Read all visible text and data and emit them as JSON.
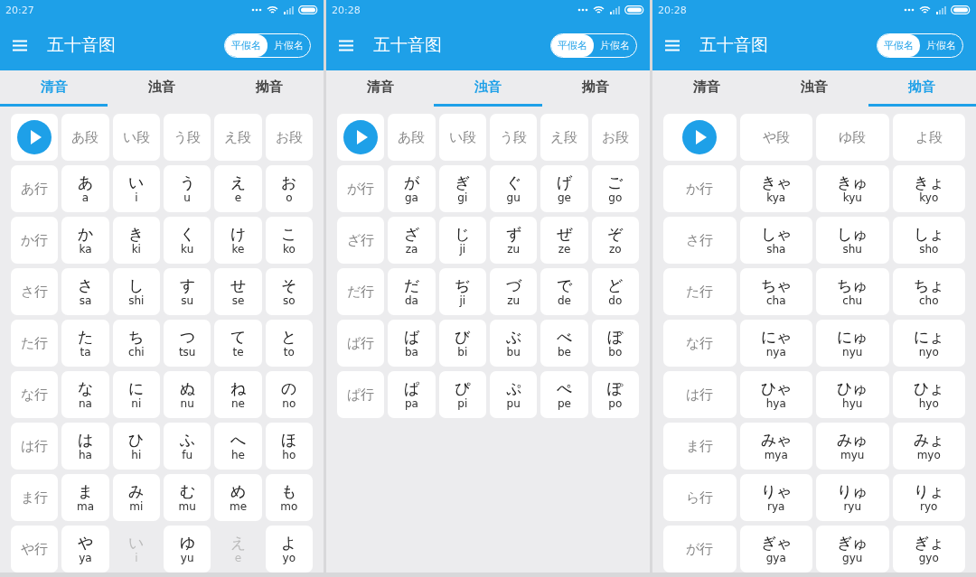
{
  "screens": [
    {
      "time": "20:27",
      "title": "五十音图",
      "toggle": [
        {
          "label": "平假名",
          "selected": true
        },
        {
          "label": "片假名",
          "selected": false
        }
      ],
      "tabs": [
        {
          "label": "清音",
          "selected": true
        },
        {
          "label": "浊音",
          "selected": false
        },
        {
          "label": "拗音",
          "selected": false
        }
      ],
      "columns": [
        "あ段",
        "い段",
        "う段",
        "え段",
        "お段"
      ],
      "rows": [
        {
          "label": "あ行",
          "cells": [
            {
              "kana": "あ",
              "romaji": "a",
              "disabled": false
            },
            {
              "kana": "い",
              "romaji": "i",
              "disabled": false
            },
            {
              "kana": "う",
              "romaji": "u",
              "disabled": false
            },
            {
              "kana": "え",
              "romaji": "e",
              "disabled": false
            },
            {
              "kana": "お",
              "romaji": "o",
              "disabled": false
            }
          ]
        },
        {
          "label": "か行",
          "cells": [
            {
              "kana": "か",
              "romaji": "ka",
              "disabled": false
            },
            {
              "kana": "き",
              "romaji": "ki",
              "disabled": false
            },
            {
              "kana": "く",
              "romaji": "ku",
              "disabled": false
            },
            {
              "kana": "け",
              "romaji": "ke",
              "disabled": false
            },
            {
              "kana": "こ",
              "romaji": "ko",
              "disabled": false
            }
          ]
        },
        {
          "label": "さ行",
          "cells": [
            {
              "kana": "さ",
              "romaji": "sa",
              "disabled": false
            },
            {
              "kana": "し",
              "romaji": "shi",
              "disabled": false
            },
            {
              "kana": "す",
              "romaji": "su",
              "disabled": false
            },
            {
              "kana": "せ",
              "romaji": "se",
              "disabled": false
            },
            {
              "kana": "そ",
              "romaji": "so",
              "disabled": false
            }
          ]
        },
        {
          "label": "た行",
          "cells": [
            {
              "kana": "た",
              "romaji": "ta",
              "disabled": false
            },
            {
              "kana": "ち",
              "romaji": "chi",
              "disabled": false
            },
            {
              "kana": "つ",
              "romaji": "tsu",
              "disabled": false
            },
            {
              "kana": "て",
              "romaji": "te",
              "disabled": false
            },
            {
              "kana": "と",
              "romaji": "to",
              "disabled": false
            }
          ]
        },
        {
          "label": "な行",
          "cells": [
            {
              "kana": "な",
              "romaji": "na",
              "disabled": false
            },
            {
              "kana": "に",
              "romaji": "ni",
              "disabled": false
            },
            {
              "kana": "ぬ",
              "romaji": "nu",
              "disabled": false
            },
            {
              "kana": "ね",
              "romaji": "ne",
              "disabled": false
            },
            {
              "kana": "の",
              "romaji": "no",
              "disabled": false
            }
          ]
        },
        {
          "label": "は行",
          "cells": [
            {
              "kana": "は",
              "romaji": "ha",
              "disabled": false
            },
            {
              "kana": "ひ",
              "romaji": "hi",
              "disabled": false
            },
            {
              "kana": "ふ",
              "romaji": "fu",
              "disabled": false
            },
            {
              "kana": "へ",
              "romaji": "he",
              "disabled": false
            },
            {
              "kana": "ほ",
              "romaji": "ho",
              "disabled": false
            }
          ]
        },
        {
          "label": "ま行",
          "cells": [
            {
              "kana": "ま",
              "romaji": "ma",
              "disabled": false
            },
            {
              "kana": "み",
              "romaji": "mi",
              "disabled": false
            },
            {
              "kana": "む",
              "romaji": "mu",
              "disabled": false
            },
            {
              "kana": "め",
              "romaji": "me",
              "disabled": false
            },
            {
              "kana": "も",
              "romaji": "mo",
              "disabled": false
            }
          ]
        },
        {
          "label": "や行",
          "cells": [
            {
              "kana": "や",
              "romaji": "ya",
              "disabled": false
            },
            {
              "kana": "い",
              "romaji": "i",
              "disabled": true
            },
            {
              "kana": "ゆ",
              "romaji": "yu",
              "disabled": false
            },
            {
              "kana": "え",
              "romaji": "e",
              "disabled": true
            },
            {
              "kana": "よ",
              "romaji": "yo",
              "disabled": false
            }
          ]
        }
      ]
    },
    {
      "time": "20:28",
      "title": "五十音图",
      "toggle": [
        {
          "label": "平假名",
          "selected": true
        },
        {
          "label": "片假名",
          "selected": false
        }
      ],
      "tabs": [
        {
          "label": "清音",
          "selected": false
        },
        {
          "label": "浊音",
          "selected": true
        },
        {
          "label": "拗音",
          "selected": false
        }
      ],
      "columns": [
        "あ段",
        "い段",
        "う段",
        "え段",
        "お段"
      ],
      "rows": [
        {
          "label": "が行",
          "cells": [
            {
              "kana": "が",
              "romaji": "ga",
              "disabled": false
            },
            {
              "kana": "ぎ",
              "romaji": "gi",
              "disabled": false
            },
            {
              "kana": "ぐ",
              "romaji": "gu",
              "disabled": false
            },
            {
              "kana": "げ",
              "romaji": "ge",
              "disabled": false
            },
            {
              "kana": "ご",
              "romaji": "go",
              "disabled": false
            }
          ]
        },
        {
          "label": "ざ行",
          "cells": [
            {
              "kana": "ざ",
              "romaji": "za",
              "disabled": false
            },
            {
              "kana": "じ",
              "romaji": "ji",
              "disabled": false
            },
            {
              "kana": "ず",
              "romaji": "zu",
              "disabled": false
            },
            {
              "kana": "ぜ",
              "romaji": "ze",
              "disabled": false
            },
            {
              "kana": "ぞ",
              "romaji": "zo",
              "disabled": false
            }
          ]
        },
        {
          "label": "だ行",
          "cells": [
            {
              "kana": "だ",
              "romaji": "da",
              "disabled": false
            },
            {
              "kana": "ぢ",
              "romaji": "ji",
              "disabled": false
            },
            {
              "kana": "づ",
              "romaji": "zu",
              "disabled": false
            },
            {
              "kana": "で",
              "romaji": "de",
              "disabled": false
            },
            {
              "kana": "ど",
              "romaji": "do",
              "disabled": false
            }
          ]
        },
        {
          "label": "ば行",
          "cells": [
            {
              "kana": "ば",
              "romaji": "ba",
              "disabled": false
            },
            {
              "kana": "び",
              "romaji": "bi",
              "disabled": false
            },
            {
              "kana": "ぶ",
              "romaji": "bu",
              "disabled": false
            },
            {
              "kana": "べ",
              "romaji": "be",
              "disabled": false
            },
            {
              "kana": "ぼ",
              "romaji": "bo",
              "disabled": false
            }
          ]
        },
        {
          "label": "ぱ行",
          "cells": [
            {
              "kana": "ぱ",
              "romaji": "pa",
              "disabled": false
            },
            {
              "kana": "ぴ",
              "romaji": "pi",
              "disabled": false
            },
            {
              "kana": "ぷ",
              "romaji": "pu",
              "disabled": false
            },
            {
              "kana": "ぺ",
              "romaji": "pe",
              "disabled": false
            },
            {
              "kana": "ぽ",
              "romaji": "po",
              "disabled": false
            }
          ]
        }
      ]
    },
    {
      "time": "20:28",
      "title": "五十音图",
      "toggle": [
        {
          "label": "平假名",
          "selected": true
        },
        {
          "label": "片假名",
          "selected": false
        }
      ],
      "tabs": [
        {
          "label": "清音",
          "selected": false
        },
        {
          "label": "浊音",
          "selected": false
        },
        {
          "label": "拗音",
          "selected": true
        }
      ],
      "columns": [
        "や段",
        "ゆ段",
        "よ段"
      ],
      "rows": [
        {
          "label": "か行",
          "cells": [
            {
              "kana": "きゃ",
              "romaji": "kya",
              "disabled": false
            },
            {
              "kana": "きゅ",
              "romaji": "kyu",
              "disabled": false
            },
            {
              "kana": "きょ",
              "romaji": "kyo",
              "disabled": false
            }
          ]
        },
        {
          "label": "さ行",
          "cells": [
            {
              "kana": "しゃ",
              "romaji": "sha",
              "disabled": false
            },
            {
              "kana": "しゅ",
              "romaji": "shu",
              "disabled": false
            },
            {
              "kana": "しょ",
              "romaji": "sho",
              "disabled": false
            }
          ]
        },
        {
          "label": "た行",
          "cells": [
            {
              "kana": "ちゃ",
              "romaji": "cha",
              "disabled": false
            },
            {
              "kana": "ちゅ",
              "romaji": "chu",
              "disabled": false
            },
            {
              "kana": "ちょ",
              "romaji": "cho",
              "disabled": false
            }
          ]
        },
        {
          "label": "な行",
          "cells": [
            {
              "kana": "にゃ",
              "romaji": "nya",
              "disabled": false
            },
            {
              "kana": "にゅ",
              "romaji": "nyu",
              "disabled": false
            },
            {
              "kana": "にょ",
              "romaji": "nyo",
              "disabled": false
            }
          ]
        },
        {
          "label": "は行",
          "cells": [
            {
              "kana": "ひゃ",
              "romaji": "hya",
              "disabled": false
            },
            {
              "kana": "ひゅ",
              "romaji": "hyu",
              "disabled": false
            },
            {
              "kana": "ひょ",
              "romaji": "hyo",
              "disabled": false
            }
          ]
        },
        {
          "label": "ま行",
          "cells": [
            {
              "kana": "みゃ",
              "romaji": "mya",
              "disabled": false
            },
            {
              "kana": "みゅ",
              "romaji": "myu",
              "disabled": false
            },
            {
              "kana": "みょ",
              "romaji": "myo",
              "disabled": false
            }
          ]
        },
        {
          "label": "ら行",
          "cells": [
            {
              "kana": "りゃ",
              "romaji": "rya",
              "disabled": false
            },
            {
              "kana": "りゅ",
              "romaji": "ryu",
              "disabled": false
            },
            {
              "kana": "りょ",
              "romaji": "ryo",
              "disabled": false
            }
          ]
        },
        {
          "label": "が行",
          "cells": [
            {
              "kana": "ぎゃ",
              "romaji": "gya",
              "disabled": false
            },
            {
              "kana": "ぎゅ",
              "romaji": "gyu",
              "disabled": false
            },
            {
              "kana": "ぎょ",
              "romaji": "gyo",
              "disabled": false
            }
          ]
        }
      ]
    }
  ]
}
